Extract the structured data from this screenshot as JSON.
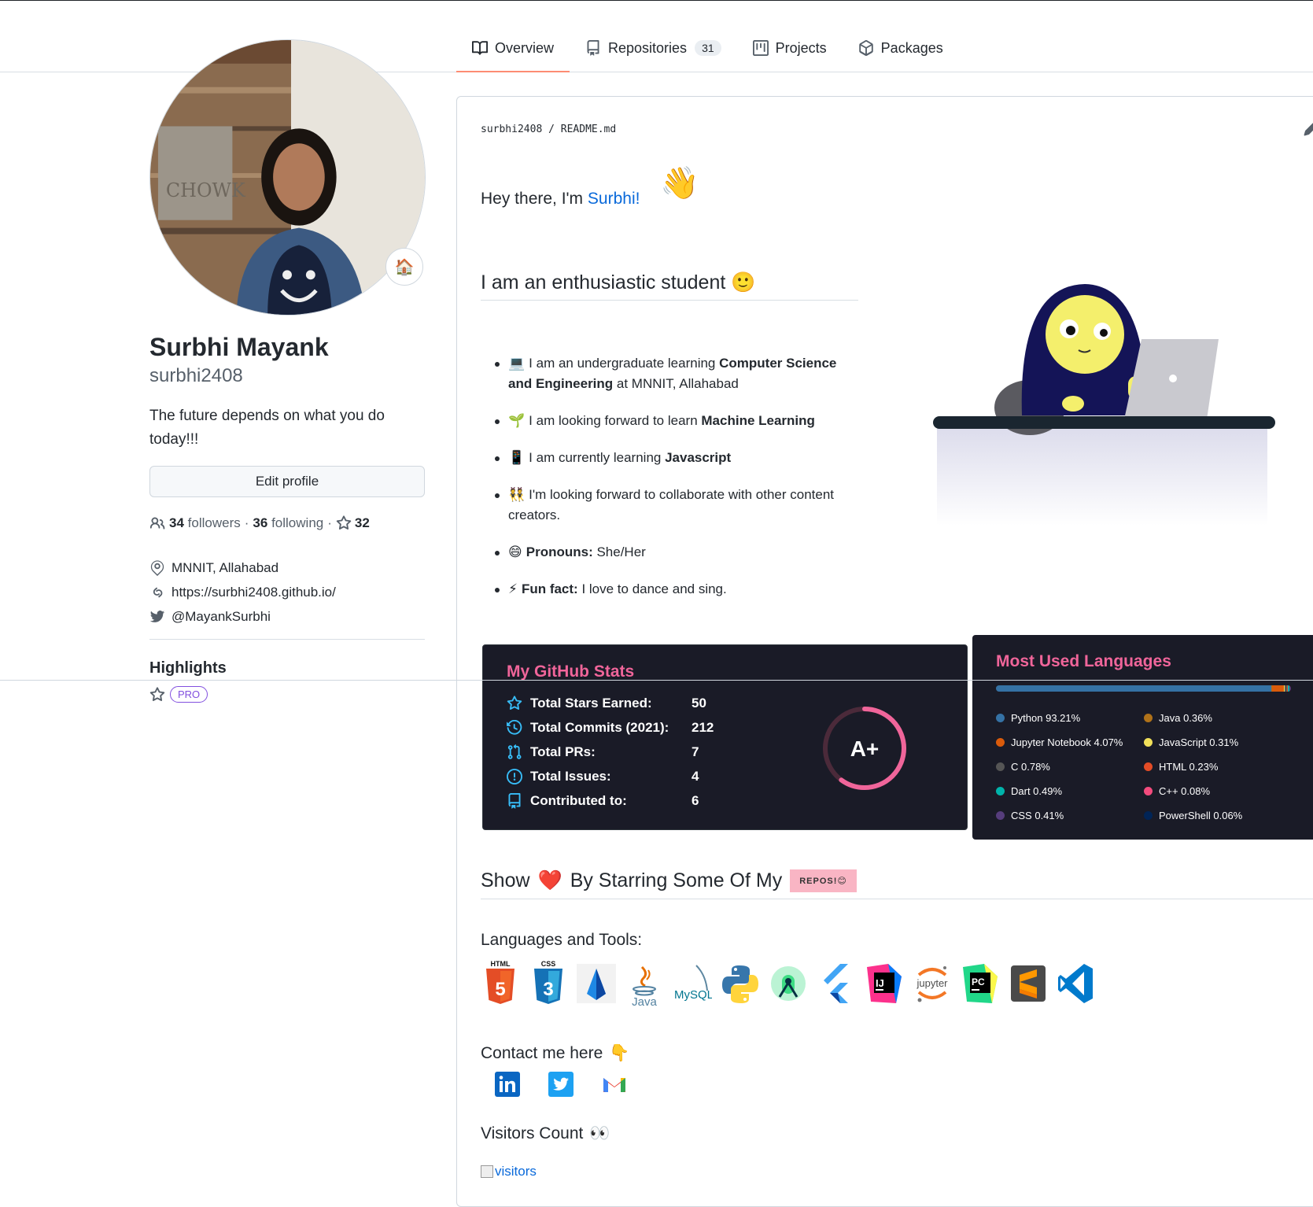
{
  "tabs": [
    {
      "label": "Overview",
      "icon": "book-icon",
      "active": true
    },
    {
      "label": "Repositories",
      "icon": "repo-icon",
      "count": "31"
    },
    {
      "label": "Projects",
      "icon": "project-icon"
    },
    {
      "label": "Packages",
      "icon": "package-icon"
    }
  ],
  "profile": {
    "fullname": "Surbhi Mayank",
    "username": "surbhi2408",
    "bio": "The future depends on what you do today!!!",
    "edit_label": "Edit profile",
    "followers_count": "34",
    "followers_label": "followers",
    "following_count": "36",
    "following_label": "following",
    "stars_count": "32",
    "location": "MNNIT, Allahabad",
    "website": "https://surbhi2408.github.io/",
    "twitter": "@MayankSurbhi",
    "highlights_title": "Highlights",
    "pro_label": "PRO"
  },
  "readme": {
    "path_user": "surbhi2408",
    "path_sep": "/",
    "path_file": "README.md",
    "greeting_prefix": "Hey there, I'm",
    "greeting_name": "Surbhi!",
    "wave_emoji": "👋",
    "heading": "I am an enthusiastic student",
    "heading_emoji": "🙂",
    "bullets": [
      {
        "emoji": "💻",
        "pre": "I am an undergraduate learning ",
        "strong": "Computer Science and Engineering",
        "post": " at MNNIT, Allahabad"
      },
      {
        "emoji": "🌱",
        "pre": "I am looking forward to learn ",
        "strong": "Machine Learning",
        "post": ""
      },
      {
        "emoji": "📱",
        "pre": "I am currently learning ",
        "strong": "Javascript",
        "post": ""
      },
      {
        "emoji": "👯",
        "pre": "I'm looking forward to collaborate with other content creators.",
        "strong": "",
        "post": ""
      },
      {
        "emoji": "😄",
        "pre": "",
        "strong": "Pronouns:",
        "post": " She/Her"
      },
      {
        "emoji": "⚡",
        "pre": "",
        "strong": "Fun fact:",
        "post": " I love to dance and sing."
      }
    ],
    "stats": {
      "title": "My GitHub Stats",
      "rows": [
        {
          "label": "Total Stars Earned:",
          "value": "50",
          "icon": "star-icon"
        },
        {
          "label": "Total Commits (2021):",
          "value": "212",
          "icon": "history-icon"
        },
        {
          "label": "Total PRs:",
          "value": "7",
          "icon": "pull-request-icon"
        },
        {
          "label": "Total Issues:",
          "value": "4",
          "icon": "issue-icon"
        },
        {
          "label": "Contributed to:",
          "value": "6",
          "icon": "repo-icon"
        }
      ],
      "grade": "A+",
      "grade_progress": 0.6
    },
    "languages": {
      "title": "Most Used Languages",
      "items": [
        {
          "name": "Python",
          "percent": "93.21%",
          "value": 93.21,
          "color": "#3572A5"
        },
        {
          "name": "Java",
          "percent": "0.36%",
          "value": 0.36,
          "color": "#b07219"
        },
        {
          "name": "Jupyter Notebook",
          "percent": "4.07%",
          "value": 4.07,
          "color": "#DA5B0B"
        },
        {
          "name": "JavaScript",
          "percent": "0.31%",
          "value": 0.31,
          "color": "#f1e05a"
        },
        {
          "name": "C",
          "percent": "0.78%",
          "value": 0.78,
          "color": "#555555"
        },
        {
          "name": "HTML",
          "percent": "0.23%",
          "value": 0.23,
          "color": "#e34c26"
        },
        {
          "name": "Dart",
          "percent": "0.49%",
          "value": 0.49,
          "color": "#00B4AB"
        },
        {
          "name": "C++",
          "percent": "0.08%",
          "value": 0.08,
          "color": "#f34b7d"
        },
        {
          "name": "CSS",
          "percent": "0.41%",
          "value": 0.41,
          "color": "#563d7c"
        },
        {
          "name": "PowerShell",
          "percent": "0.06%",
          "value": 0.06,
          "color": "#012456"
        }
      ]
    },
    "show_prefix": "Show",
    "show_heart": "❤️",
    "show_suffix": "By Starring Some Of My",
    "repos_badge": "REPOS!😊",
    "tools_heading": "Languages and Tools:",
    "tools": [
      "html5-icon",
      "css3-icon",
      "android-studio-icon",
      "java-icon",
      "mysql-icon",
      "python-icon",
      "android-icon",
      "flutter-icon",
      "intellij-icon",
      "jupyter-icon",
      "pycharm-icon",
      "sublime-icon",
      "vscode-icon"
    ],
    "tool_texts": {
      "html": "HTML",
      "css": "CSS",
      "java": "Java",
      "mysql": "MySQL",
      "ij": "IJ",
      "jupyter": "jupyter",
      "pc": "PC"
    },
    "contact_heading": "Contact me here",
    "contact_emoji": "👇",
    "contacts": [
      "linkedin-icon",
      "twitter-icon",
      "gmail-icon"
    ],
    "visitors_heading": "Visitors Count",
    "visitors_emoji": "👀",
    "visitors_alt": "visitors"
  }
}
